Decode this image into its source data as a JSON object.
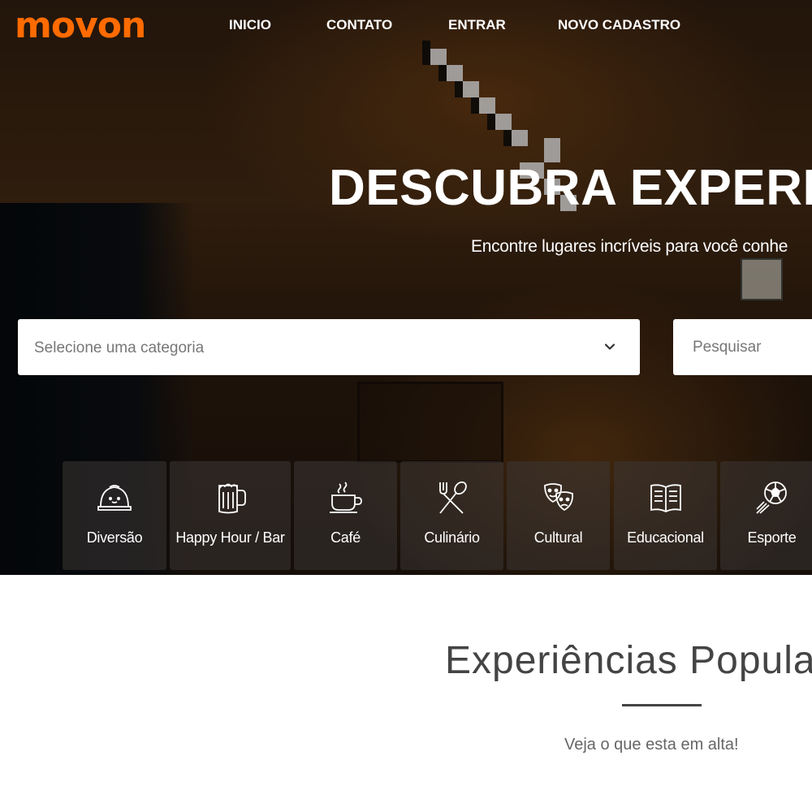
{
  "brand": {
    "logo": "movon",
    "accent": "#ff6b00"
  },
  "nav": {
    "items": [
      {
        "label": "INICIO"
      },
      {
        "label": "CONTATO"
      },
      {
        "label": "ENTRAR"
      },
      {
        "label": "NOVO CADASTRO"
      }
    ]
  },
  "hero": {
    "headline": "DESCUBRA EXPERIÊ",
    "subheadline": "Encontre lugares incríveis para você conhe",
    "category_select": {
      "placeholder": "Selecione uma categoria",
      "icon": "chevron-down-icon"
    },
    "search": {
      "placeholder": "Pesquisar"
    }
  },
  "categories": [
    {
      "label": "Diversão",
      "icon": "helmet-icon"
    },
    {
      "label": "Happy Hour / Bar",
      "icon": "beer-mug-icon"
    },
    {
      "label": "Café",
      "icon": "coffee-cup-icon"
    },
    {
      "label": "Culinário",
      "icon": "fork-spoon-icon"
    },
    {
      "label": "Cultural",
      "icon": "theater-masks-icon"
    },
    {
      "label": "Educacional",
      "icon": "open-book-icon"
    },
    {
      "label": "Esporte",
      "icon": "soccer-ball-icon"
    }
  ],
  "popular": {
    "title": "Experiências Popula",
    "subtitle": "Veja o que esta em alta!"
  }
}
